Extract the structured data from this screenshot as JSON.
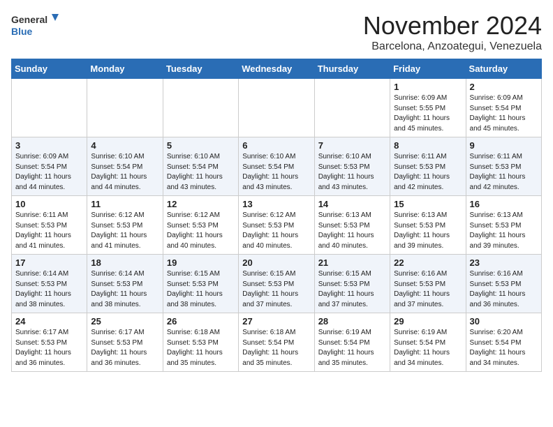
{
  "header": {
    "logo_general": "General",
    "logo_blue": "Blue",
    "month": "November 2024",
    "location": "Barcelona, Anzoategui, Venezuela"
  },
  "days_of_week": [
    "Sunday",
    "Monday",
    "Tuesday",
    "Wednesday",
    "Thursday",
    "Friday",
    "Saturday"
  ],
  "weeks": [
    [
      {
        "day": "",
        "info": ""
      },
      {
        "day": "",
        "info": ""
      },
      {
        "day": "",
        "info": ""
      },
      {
        "day": "",
        "info": ""
      },
      {
        "day": "",
        "info": ""
      },
      {
        "day": "1",
        "info": "Sunrise: 6:09 AM\nSunset: 5:55 PM\nDaylight: 11 hours and 45 minutes."
      },
      {
        "day": "2",
        "info": "Sunrise: 6:09 AM\nSunset: 5:54 PM\nDaylight: 11 hours and 45 minutes."
      }
    ],
    [
      {
        "day": "3",
        "info": "Sunrise: 6:09 AM\nSunset: 5:54 PM\nDaylight: 11 hours and 44 minutes."
      },
      {
        "day": "4",
        "info": "Sunrise: 6:10 AM\nSunset: 5:54 PM\nDaylight: 11 hours and 44 minutes."
      },
      {
        "day": "5",
        "info": "Sunrise: 6:10 AM\nSunset: 5:54 PM\nDaylight: 11 hours and 43 minutes."
      },
      {
        "day": "6",
        "info": "Sunrise: 6:10 AM\nSunset: 5:54 PM\nDaylight: 11 hours and 43 minutes."
      },
      {
        "day": "7",
        "info": "Sunrise: 6:10 AM\nSunset: 5:53 PM\nDaylight: 11 hours and 43 minutes."
      },
      {
        "day": "8",
        "info": "Sunrise: 6:11 AM\nSunset: 5:53 PM\nDaylight: 11 hours and 42 minutes."
      },
      {
        "day": "9",
        "info": "Sunrise: 6:11 AM\nSunset: 5:53 PM\nDaylight: 11 hours and 42 minutes."
      }
    ],
    [
      {
        "day": "10",
        "info": "Sunrise: 6:11 AM\nSunset: 5:53 PM\nDaylight: 11 hours and 41 minutes."
      },
      {
        "day": "11",
        "info": "Sunrise: 6:12 AM\nSunset: 5:53 PM\nDaylight: 11 hours and 41 minutes."
      },
      {
        "day": "12",
        "info": "Sunrise: 6:12 AM\nSunset: 5:53 PM\nDaylight: 11 hours and 40 minutes."
      },
      {
        "day": "13",
        "info": "Sunrise: 6:12 AM\nSunset: 5:53 PM\nDaylight: 11 hours and 40 minutes."
      },
      {
        "day": "14",
        "info": "Sunrise: 6:13 AM\nSunset: 5:53 PM\nDaylight: 11 hours and 40 minutes."
      },
      {
        "day": "15",
        "info": "Sunrise: 6:13 AM\nSunset: 5:53 PM\nDaylight: 11 hours and 39 minutes."
      },
      {
        "day": "16",
        "info": "Sunrise: 6:13 AM\nSunset: 5:53 PM\nDaylight: 11 hours and 39 minutes."
      }
    ],
    [
      {
        "day": "17",
        "info": "Sunrise: 6:14 AM\nSunset: 5:53 PM\nDaylight: 11 hours and 38 minutes."
      },
      {
        "day": "18",
        "info": "Sunrise: 6:14 AM\nSunset: 5:53 PM\nDaylight: 11 hours and 38 minutes."
      },
      {
        "day": "19",
        "info": "Sunrise: 6:15 AM\nSunset: 5:53 PM\nDaylight: 11 hours and 38 minutes."
      },
      {
        "day": "20",
        "info": "Sunrise: 6:15 AM\nSunset: 5:53 PM\nDaylight: 11 hours and 37 minutes."
      },
      {
        "day": "21",
        "info": "Sunrise: 6:15 AM\nSunset: 5:53 PM\nDaylight: 11 hours and 37 minutes."
      },
      {
        "day": "22",
        "info": "Sunrise: 6:16 AM\nSunset: 5:53 PM\nDaylight: 11 hours and 37 minutes."
      },
      {
        "day": "23",
        "info": "Sunrise: 6:16 AM\nSunset: 5:53 PM\nDaylight: 11 hours and 36 minutes."
      }
    ],
    [
      {
        "day": "24",
        "info": "Sunrise: 6:17 AM\nSunset: 5:53 PM\nDaylight: 11 hours and 36 minutes."
      },
      {
        "day": "25",
        "info": "Sunrise: 6:17 AM\nSunset: 5:53 PM\nDaylight: 11 hours and 36 minutes."
      },
      {
        "day": "26",
        "info": "Sunrise: 6:18 AM\nSunset: 5:53 PM\nDaylight: 11 hours and 35 minutes."
      },
      {
        "day": "27",
        "info": "Sunrise: 6:18 AM\nSunset: 5:54 PM\nDaylight: 11 hours and 35 minutes."
      },
      {
        "day": "28",
        "info": "Sunrise: 6:19 AM\nSunset: 5:54 PM\nDaylight: 11 hours and 35 minutes."
      },
      {
        "day": "29",
        "info": "Sunrise: 6:19 AM\nSunset: 5:54 PM\nDaylight: 11 hours and 34 minutes."
      },
      {
        "day": "30",
        "info": "Sunrise: 6:20 AM\nSunset: 5:54 PM\nDaylight: 11 hours and 34 minutes."
      }
    ]
  ]
}
